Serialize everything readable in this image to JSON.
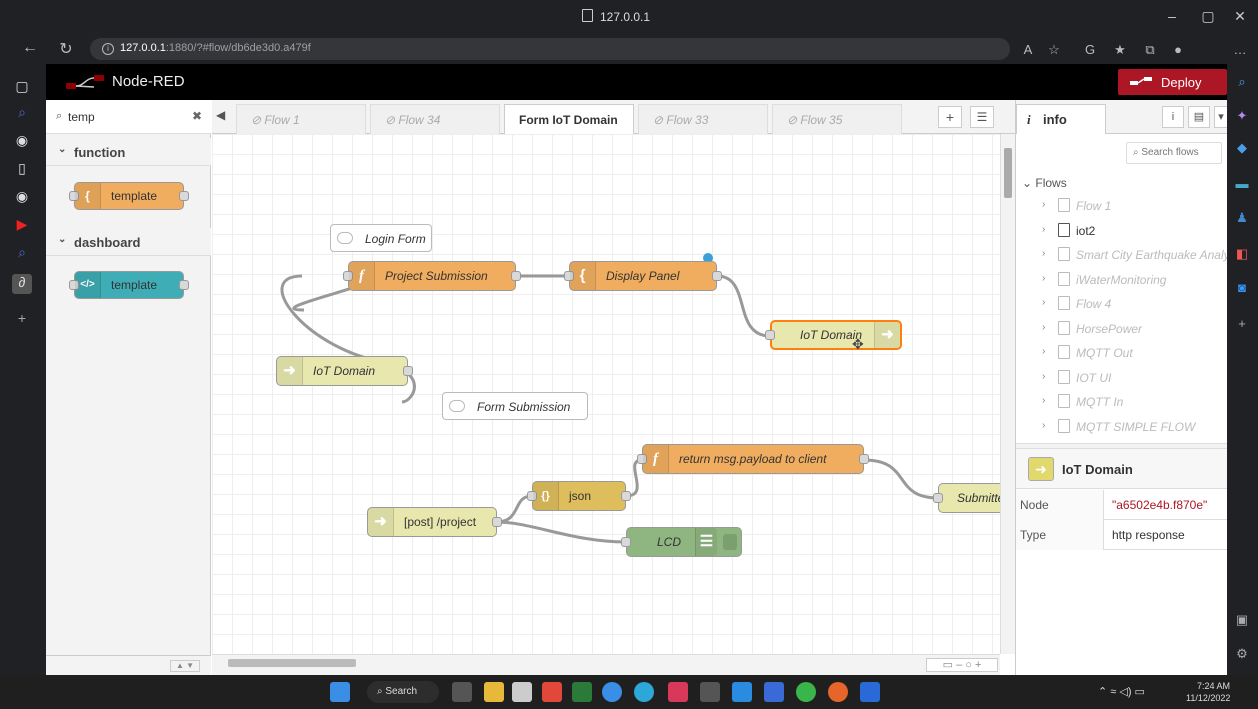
{
  "browser": {
    "window_title": "127.0.0.1",
    "url_host": "127.0.0.1",
    "url_path": ":1880/?#flow/db6de3d0.a479f"
  },
  "app": {
    "title": "Node-RED",
    "deploy_label": "Deploy"
  },
  "palette": {
    "search_value": "temp",
    "categories": [
      {
        "label": "function",
        "node_label": "template",
        "color": "#f0ad5f"
      },
      {
        "label": "dashboard",
        "node_label": "template",
        "color": "#3fadb5"
      }
    ]
  },
  "tabs": {
    "items": [
      {
        "label": "Flow 1",
        "active": false
      },
      {
        "label": "Flow 34",
        "active": false
      },
      {
        "label": "Form IoT Domain",
        "active": true
      },
      {
        "label": "Flow 33",
        "active": false
      },
      {
        "label": "Flow 35",
        "active": false
      }
    ]
  },
  "flow": {
    "comments": {
      "login_form": "Login Form",
      "form_submission": "Form Submission"
    },
    "nodes": {
      "project_submission": "Project Submission",
      "display_panel": "Display Panel",
      "iot_domain_response": "IoT Domain",
      "iot_domain_in": "IoT Domain",
      "return_msg": "return msg.payload to client",
      "json": "json",
      "submitted": "Submitted",
      "post_project": "[post] /project",
      "lcd": "LCD"
    },
    "colors": {
      "function": "#f0ad5f",
      "template": "#f0ad5f",
      "http": "#e7e7ae",
      "json": "#debd5c",
      "ui": "#8fb580"
    }
  },
  "sidebar": {
    "tab_label": "info",
    "search_placeholder": "Search flows",
    "flows_heading": "Flows",
    "flows": [
      {
        "label": "Flow 1",
        "enabled": false
      },
      {
        "label": "iot2",
        "enabled": true
      },
      {
        "label": "Smart City Earthquake Analysis",
        "enabled": false
      },
      {
        "label": "iWaterMonitoring",
        "enabled": false
      },
      {
        "label": "Flow 4",
        "enabled": false
      },
      {
        "label": "HorsePower",
        "enabled": false
      },
      {
        "label": "MQTT Out",
        "enabled": false
      },
      {
        "label": "IOT UI",
        "enabled": false
      },
      {
        "label": "MQTT In",
        "enabled": false
      },
      {
        "label": "MQTT SIMPLE FLOW",
        "enabled": false
      }
    ],
    "selected": {
      "title": "IoT Domain",
      "properties": [
        {
          "key": "Node",
          "value": "\"a6502e4b.f870e\""
        },
        {
          "key": "Type",
          "value": "http response"
        }
      ]
    }
  },
  "taskbar": {
    "search_label": "Search",
    "time": "7:24 AM",
    "date": "11/12/2022"
  }
}
